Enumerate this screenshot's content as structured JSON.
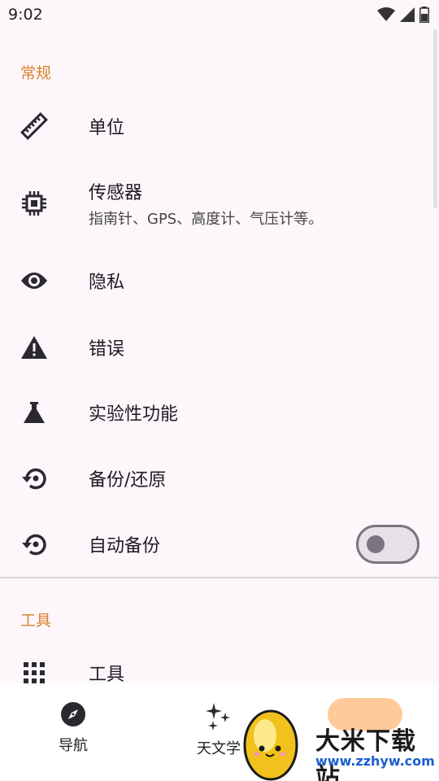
{
  "status_bar": {
    "time": "9:02",
    "icons": [
      "wifi-icon",
      "signal-icon",
      "battery-icon"
    ]
  },
  "sections": {
    "general": "常规",
    "tools": "工具"
  },
  "items": {
    "units": {
      "title": "单位",
      "icon": "ruler-icon"
    },
    "sensors": {
      "title": "传感器",
      "subtitle": "指南针、GPS、高度计、气压计等。",
      "icon": "chip-icon"
    },
    "privacy": {
      "title": "隐私",
      "icon": "eye-icon"
    },
    "errors": {
      "title": "错误",
      "icon": "warning-icon"
    },
    "experimental": {
      "title": "实验性功能",
      "icon": "flask-icon"
    },
    "backup": {
      "title": "备份/还原",
      "icon": "restore-icon"
    },
    "auto_backup": {
      "title": "自动备份",
      "icon": "restore-icon",
      "toggle_on": false
    },
    "tools": {
      "title": "工具",
      "icon": "grid-icon"
    }
  },
  "bottom_nav": {
    "navigation": {
      "label": "导航",
      "icon": "compass-icon"
    },
    "astronomy": {
      "label": "天文学",
      "icon": "sparkles-icon"
    }
  },
  "watermark": {
    "text": "大米下载站",
    "url": "www.zzhyw.com"
  },
  "colors": {
    "accent": "#d9822b",
    "background": "#fdf7fc",
    "icon": "#2b2930",
    "nav_pill": "#ffc999"
  }
}
